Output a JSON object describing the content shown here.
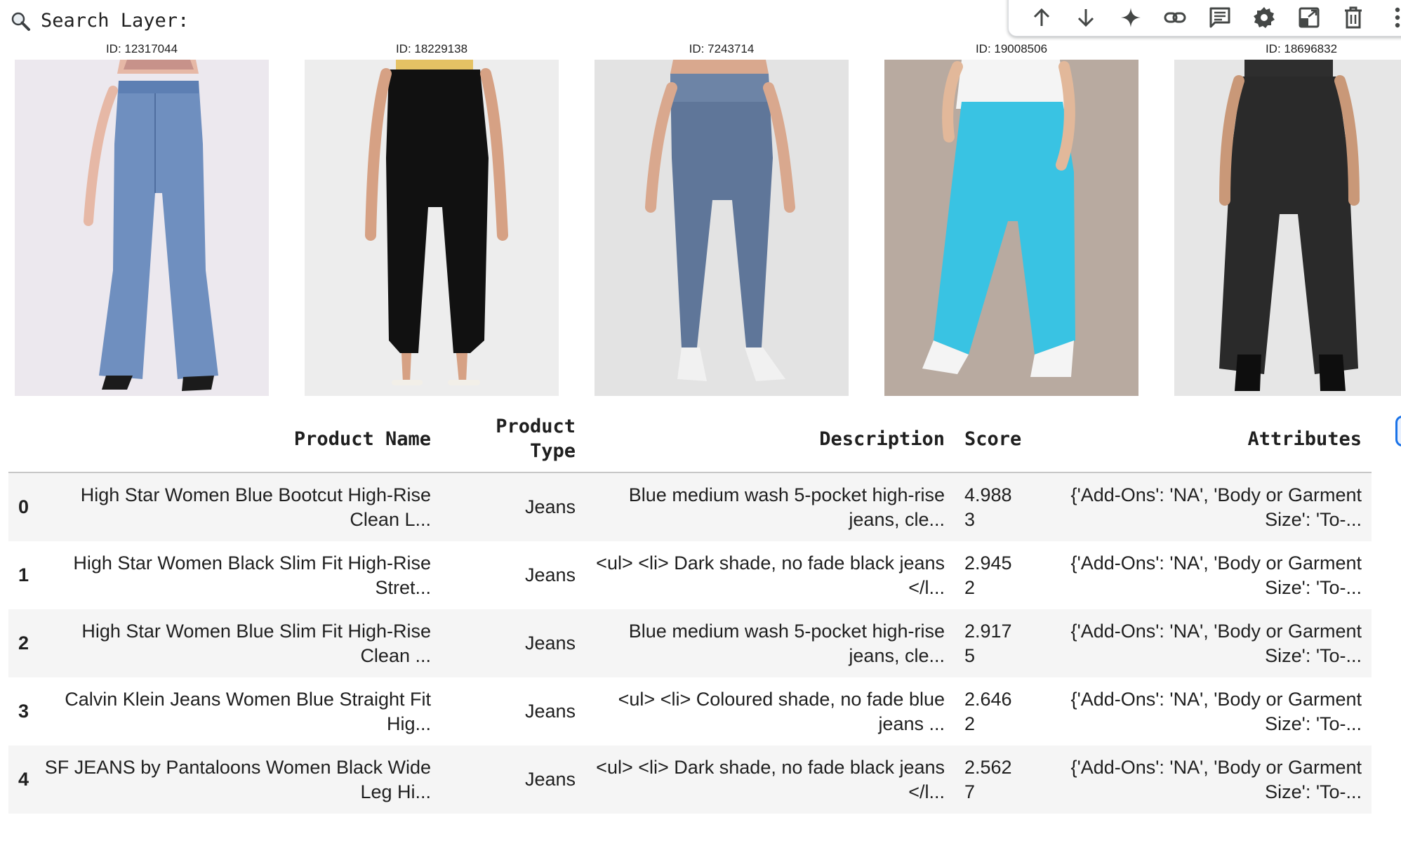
{
  "search": {
    "label": "Search Layer:",
    "icon": "magnifier-icon"
  },
  "toolbar": {
    "buttons": [
      {
        "name": "move-up",
        "icon": "arrow-up-icon"
      },
      {
        "name": "move-down",
        "icon": "arrow-down-icon"
      },
      {
        "name": "gemini",
        "icon": "sparkle-icon"
      },
      {
        "name": "link",
        "icon": "link-icon"
      },
      {
        "name": "comment",
        "icon": "comment-icon"
      },
      {
        "name": "settings",
        "icon": "gear-icon"
      },
      {
        "name": "mirror",
        "icon": "mirror-cell-icon"
      },
      {
        "name": "delete",
        "icon": "trash-icon"
      },
      {
        "name": "more",
        "icon": "more-vert-icon"
      }
    ]
  },
  "gallery": [
    {
      "id_label": "ID: 12317044",
      "color": "#6f8fbf"
    },
    {
      "id_label": "ID: 18229138",
      "color": "#111111"
    },
    {
      "id_label": "ID: 7243714",
      "color": "#5f7699"
    },
    {
      "id_label": "ID: 19008506",
      "color": "#39c3e3"
    },
    {
      "id_label": "ID: 18696832",
      "color": "#2a2a2a"
    }
  ],
  "table": {
    "headers": {
      "index": "",
      "product_name": "Product Name",
      "product_type": "Product Type",
      "description": "Description",
      "score": "Score",
      "attributes": "Attributes"
    },
    "rows": [
      {
        "index": "0",
        "product_name": "High Star Women Blue Bootcut High-Rise Clean L...",
        "product_type": "Jeans",
        "description": "Blue medium wash 5-pocket high-rise jeans, cle...",
        "score": "4.9883",
        "attributes": "{'Add-Ons': 'NA', 'Body or Garment Size': 'To-..."
      },
      {
        "index": "1",
        "product_name": "High Star Women Black Slim Fit High-Rise Stret...",
        "product_type": "Jeans",
        "description": "<ul> <li> Dark shade, no fade black jeans </l...",
        "score": "2.9452",
        "attributes": "{'Add-Ons': 'NA', 'Body or Garment Size': 'To-..."
      },
      {
        "index": "2",
        "product_name": "High Star Women Blue Slim Fit High-Rise Clean ...",
        "product_type": "Jeans",
        "description": "Blue medium wash 5-pocket high-rise jeans, cle...",
        "score": "2.9175",
        "attributes": "{'Add-Ons': 'NA', 'Body or Garment Size': 'To-..."
      },
      {
        "index": "3",
        "product_name": "Calvin Klein Jeans Women Blue Straight Fit Hig...",
        "product_type": "Jeans",
        "description": "<ul> <li> Coloured shade, no fade blue jeans ...",
        "score": "2.6462",
        "attributes": "{'Add-Ons': 'NA', 'Body or Garment Size': 'To-..."
      },
      {
        "index": "4",
        "product_name": "SF JEANS by Pantaloons Women Black Wide Leg Hi...",
        "product_type": "Jeans",
        "description": "<ul> <li> Dark shade, no fade black jeans </l...",
        "score": "2.5627",
        "attributes": "{'Add-Ons': 'NA', 'Body or Garment Size': 'To-..."
      }
    ]
  }
}
